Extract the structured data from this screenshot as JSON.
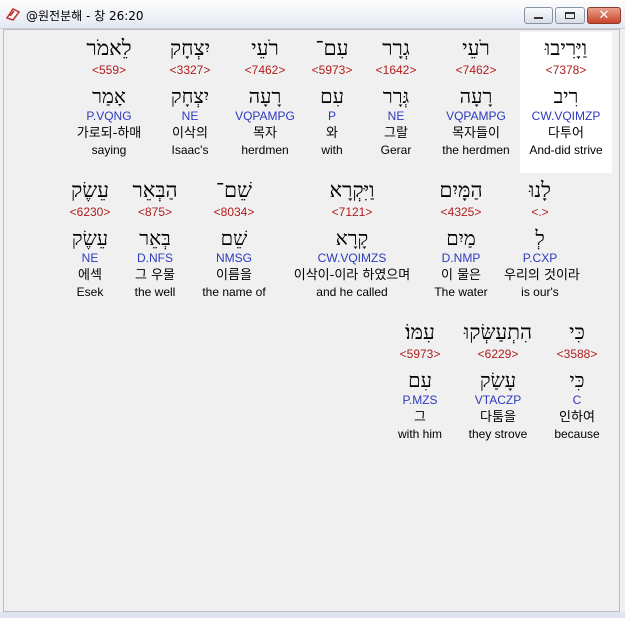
{
  "window": {
    "title": "@원전분해 - 창 26:20",
    "icon": "app-logo-icon",
    "controls": {
      "minimize": "minimize-icon",
      "maximize": "maximize-icon",
      "close": "close-icon",
      "close_glyph": "✕"
    },
    "close_color": "#c9442a"
  },
  "colors": {
    "strong": "#b01c1c",
    "parse": "#2d3bbf",
    "highlight": "#ffffff"
  },
  "rows": [
    {
      "words": [
        {
          "heb": "וַיָּרִיבוּ",
          "strong": "<7378>",
          "lemma": "רִיב",
          "parse": "CW.VQIMZP",
          "kor": "다투어",
          "eng": "And-did strive",
          "selected": true
        },
        {
          "heb": "רֹעֵי",
          "strong": "<7462>",
          "lemma": "רָעָה",
          "parse": "VQPAMPG",
          "kor": "목자들이",
          "eng": "the herdmen"
        },
        {
          "heb": "גְרָר",
          "strong": "<1642>",
          "lemma": "גְּרָר",
          "parse": "NE",
          "kor": "그랄",
          "eng": "Gerar"
        },
        {
          "heb": "עִם־",
          "strong": "<5973>",
          "lemma": "עִם",
          "parse": "P",
          "kor": "와",
          "eng": "with"
        },
        {
          "heb": "רֹעֵי",
          "strong": "<7462>",
          "lemma": "רָעָה",
          "parse": "VQPAMPG",
          "kor": "목자",
          "eng": "herdmen"
        },
        {
          "heb": "יִצְחָק",
          "strong": "<3327>",
          "lemma": "יִצְחָק",
          "parse": "NE",
          "kor": "이삭의",
          "eng": "Isaac's"
        },
        {
          "heb": "לֵאמֹר",
          "strong": "<559>",
          "lemma": "אָמַר",
          "parse": "P.VQNG",
          "kor": "가로되-하매",
          "eng": "saying"
        }
      ]
    },
    {
      "words": [
        {
          "heb": "לָנוּ",
          "strong": "<.>",
          "lemma": "לְ",
          "parse": "P.CXP",
          "kor": "우리의 것이라",
          "eng": "is our's"
        },
        {
          "heb": "הַמָּיִם",
          "strong": "<4325>",
          "lemma": "מַיִם",
          "parse": "D.NMP",
          "kor": "이 물은",
          "eng": "The water"
        },
        {
          "heb": "וַיִּקְרָא",
          "strong": "<7121>",
          "lemma": "קָרָא",
          "parse": "CW.VQIMZS",
          "kor": "이삭이-이라 하였으며",
          "eng": "and he called"
        },
        {
          "heb": "שֵׁם־",
          "strong": "<8034>",
          "lemma": "שֵׁם",
          "parse": "NMSG",
          "kor": "이름을",
          "eng": "the name of"
        },
        {
          "heb": "הַבְּאֵר",
          "strong": "<875>",
          "lemma": "בְּאֵר",
          "parse": "D.NFS",
          "kor": "그 우물",
          "eng": "the well"
        },
        {
          "heb": "עֵשֶׂק",
          "strong": "<6230>",
          "lemma": "עֵשֶׂק",
          "parse": "NE",
          "kor": "에섹",
          "eng": "Esek"
        }
      ]
    },
    {
      "words": [
        {
          "heb": "כִּי",
          "strong": "<3588>",
          "lemma": "כִּי",
          "parse": "C",
          "kor": "인하여",
          "eng": "because"
        },
        {
          "heb": "הִתְעַשְּׂקוּ",
          "strong": "<6229>",
          "lemma": "עָשַׂק",
          "parse": "VTACZP",
          "kor": "다툼을",
          "eng": "they strove"
        },
        {
          "heb": "עִמּוֹ׃",
          "strong": "<5973>",
          "lemma": "עִם",
          "parse": "P.MZS",
          "kor": "그",
          "eng": "with him"
        }
      ]
    }
  ]
}
